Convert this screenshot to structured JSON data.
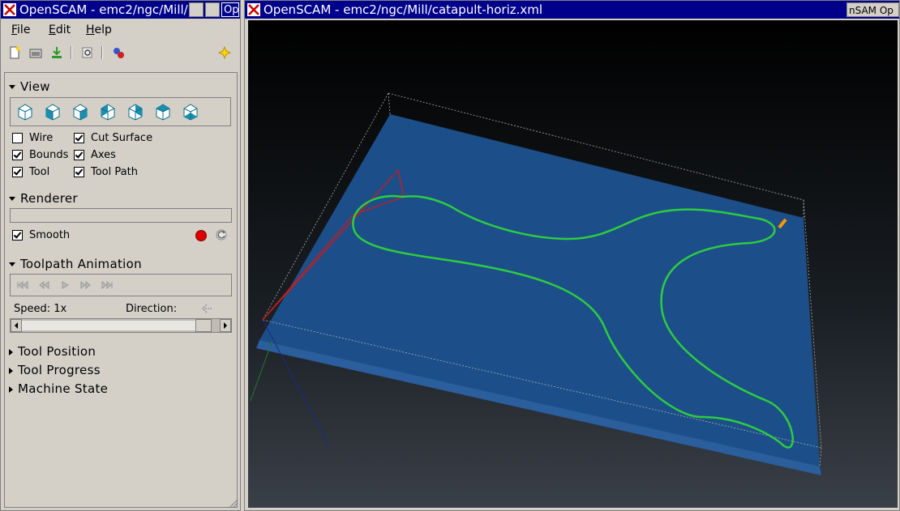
{
  "left_window": {
    "title": "OpenSCAM - emc2/ngc/Mill/",
    "title_extra": "Op"
  },
  "right_window": {
    "title": "OpenSCAM - emc2/ngc/Mill/catapult-horiz.xml",
    "title_extra": "nSAM Op"
  },
  "menu": {
    "file": "File",
    "edit": "Edit",
    "help": "Help"
  },
  "toolbar": {
    "icons": [
      "new-file-icon",
      "open-folder-icon",
      "export-icon",
      "find-icon",
      "simulate-icon",
      "star-icon"
    ]
  },
  "view": {
    "title": "View",
    "checkboxes": {
      "wire": {
        "label": "Wire",
        "checked": false
      },
      "cut_surface": {
        "label": "Cut Surface",
        "checked": true
      },
      "bounds": {
        "label": "Bounds",
        "checked": true
      },
      "axes": {
        "label": "Axes",
        "checked": true
      },
      "tool": {
        "label": "Tool",
        "checked": true
      },
      "tool_path": {
        "label": "Tool Path",
        "checked": true
      }
    }
  },
  "renderer": {
    "title": "Renderer",
    "smooth": {
      "label": "Smooth",
      "checked": true
    }
  },
  "animation": {
    "title": "Toolpath Animation",
    "speed_label": "Speed:",
    "speed_value": "1x",
    "direction_label": "Direction:"
  },
  "collapsed_sections": {
    "tool_position": "Tool Position",
    "tool_progress": "Tool Progress",
    "machine_state": "Machine State"
  },
  "colors": {
    "titlebar": "#00008b",
    "stock": "#1e4f8c",
    "toolpath": "#2ecc40",
    "tool": "#ff9900",
    "record": "#dd0000"
  }
}
